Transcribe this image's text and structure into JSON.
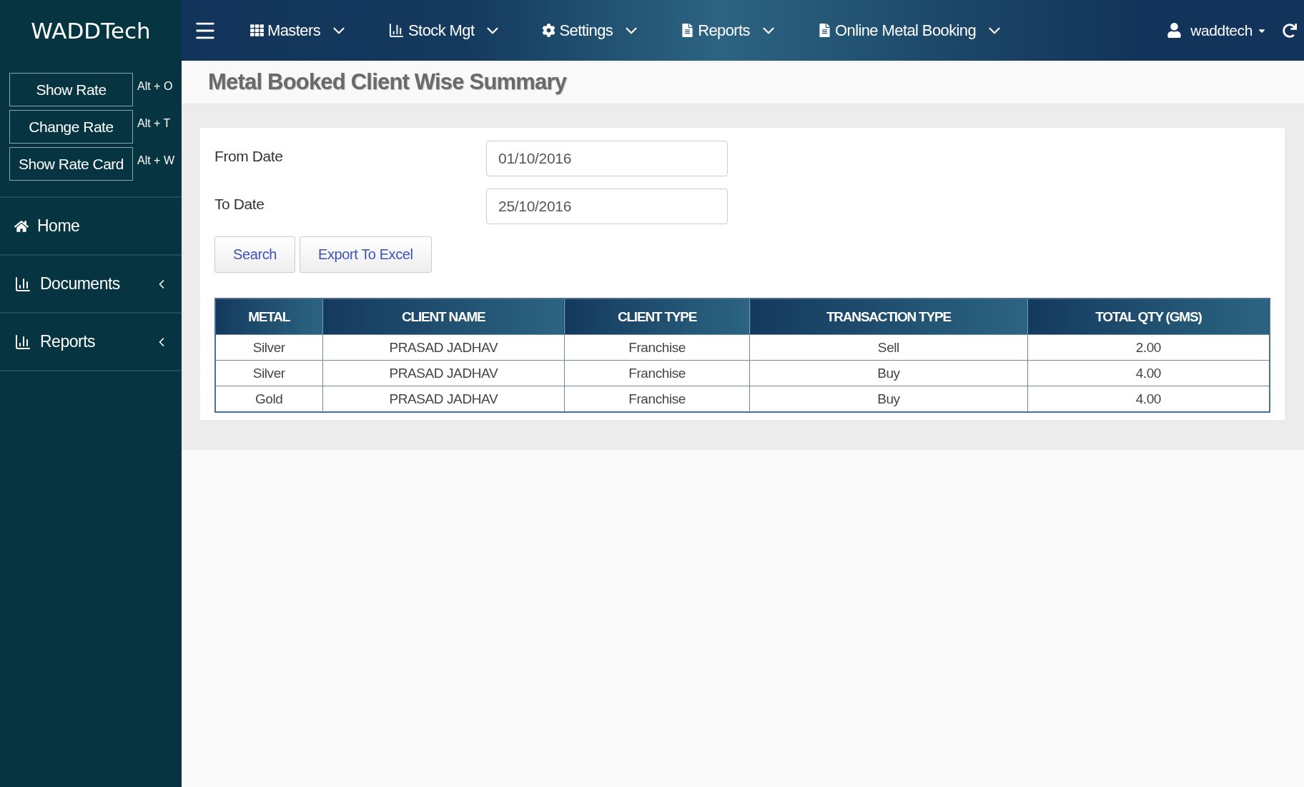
{
  "brand": "WADDTech",
  "nav": [
    {
      "label": "Masters",
      "kind": "grid"
    },
    {
      "label": "Stock Mgt",
      "kind": "chart"
    },
    {
      "label": "Settings",
      "kind": "gear"
    },
    {
      "label": "Reports",
      "kind": "document"
    },
    {
      "label": "Online Metal Booking",
      "kind": "document"
    }
  ],
  "user": "waddtech",
  "shortcuts": [
    {
      "label": "Show Rate",
      "key": "Alt + O"
    },
    {
      "label": "Change Rate",
      "key": "Alt + T"
    },
    {
      "label": "Show Rate Card",
      "key": "Alt + W"
    }
  ],
  "sidebar_menu": [
    {
      "label": "Home",
      "kind": "home",
      "has_submenu": false
    },
    {
      "label": "Documents",
      "kind": "chart",
      "has_submenu": true
    },
    {
      "label": "Reports",
      "kind": "chart",
      "has_submenu": true
    }
  ],
  "page_title": "Metal Booked Client Wise Summary",
  "filters": [
    {
      "label": "From Date",
      "value": "01/10/2016"
    },
    {
      "label": "To Date",
      "value": "25/10/2016"
    }
  ],
  "buttons": [
    "Search",
    "Export To Excel"
  ],
  "table": {
    "columns": [
      "METAL",
      "CLIENT NAME",
      "CLIENT TYPE",
      "TRANSACTION TYPE",
      "TOTAL QTY (GMS)"
    ],
    "rows": [
      [
        "Silver",
        "PRASAD JADHAV",
        "Franchise",
        "Sell",
        "2.00"
      ],
      [
        "Silver",
        "PRASAD JADHAV",
        "Franchise",
        "Buy",
        "4.00"
      ],
      [
        "Gold",
        "PRASAD JADHAV",
        "Franchise",
        "Buy",
        "4.00"
      ]
    ]
  }
}
